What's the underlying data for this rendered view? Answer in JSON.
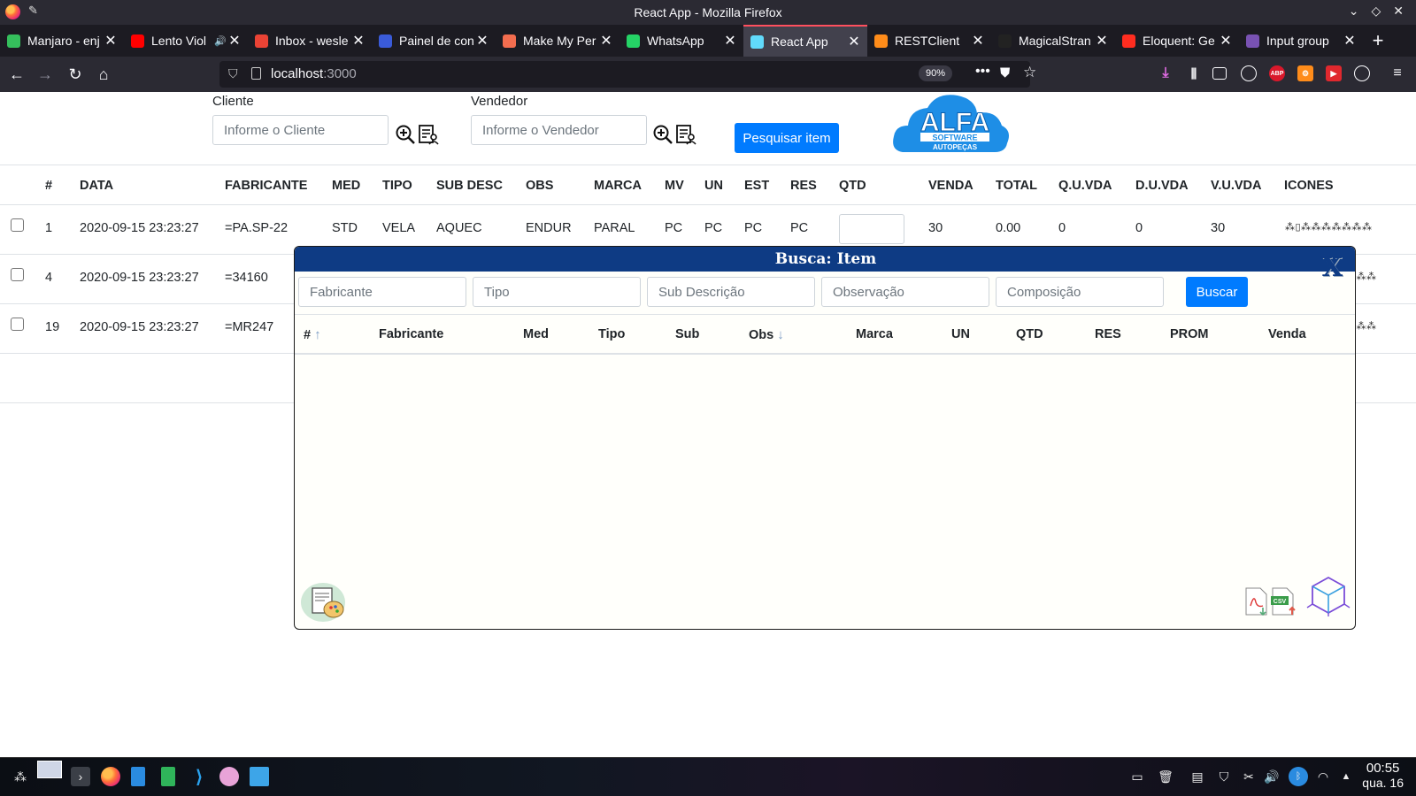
{
  "window": {
    "title": "React App - Mozilla Firefox"
  },
  "tabs": [
    {
      "label": "Manjaro - enj",
      "icon": "manjaro-icon",
      "color": "#35bf5c"
    },
    {
      "label": "Lento Viol",
      "icon": "youtube-icon",
      "color": "#ff0000"
    },
    {
      "label": "Inbox - wesle",
      "icon": "gmail-icon",
      "color": "#ea4335"
    },
    {
      "label": "Painel de con",
      "icon": "panel-icon",
      "color": "#3a5bd9"
    },
    {
      "label": "Make My Per",
      "icon": "make-icon",
      "color": "#f36d4f"
    },
    {
      "label": "WhatsApp",
      "icon": "whatsapp-icon",
      "color": "#25d366"
    },
    {
      "label": "React App",
      "icon": "react-icon",
      "color": "#61dafb"
    },
    {
      "label": "RESTClient",
      "icon": "restclient-icon",
      "color": "#ff8c1a"
    },
    {
      "label": "MagicalStran",
      "icon": "github-icon",
      "color": "#222222"
    },
    {
      "label": "Eloquent: Ge",
      "icon": "laravel-icon",
      "color": "#ff2d20"
    },
    {
      "label": "Input group",
      "icon": "bootstrap-icon",
      "color": "#7952b3"
    }
  ],
  "navbar": {
    "url_host": "localhost",
    "url_port": ":3000",
    "zoom": "90%"
  },
  "filters": {
    "cliente_label": "Cliente",
    "cliente_placeholder": "Informe o Cliente",
    "vendedor_label": "Vendedor",
    "vendedor_placeholder": "Informe o Vendedor",
    "search_button": "Pesquisar item"
  },
  "logo": {
    "text": "ALFA",
    "line1": "SOFTWARE",
    "line2": "AUTOPEÇAS",
    "color": "#1e8ee6"
  },
  "table": {
    "headers": [
      "#",
      "DATA",
      "FABRICANTE",
      "MED",
      "TIPO",
      "SUB DESC",
      "OBS",
      "MARCA",
      "MV",
      "UN",
      "EST",
      "RES",
      "QTD",
      "VENDA",
      "TOTAL",
      "Q.U.VDA",
      "D.U.VDA",
      "V.U.VDA",
      "ICONES"
    ],
    "rows": [
      {
        "num": "1",
        "data": "2020-09-15 23:23:27",
        "fabricante": "=PA.SP-22",
        "med": "STD",
        "tipo": "VELA",
        "sub": "AQUEC",
        "obs": "ENDUR",
        "marca": "PARAL",
        "mv": "PC",
        "un": "PC",
        "est": "PC",
        "res": "PC",
        "venda": "30",
        "total": "0.00",
        "quvda": "0",
        "duvda": "0",
        "vuvda": "30"
      },
      {
        "num": "4",
        "data": "2020-09-15 23:23:27",
        "fabricante": "=34160"
      },
      {
        "num": "19",
        "data": "2020-09-15 23:23:27",
        "fabricante": "=MR247"
      }
    ]
  },
  "modal": {
    "title": "Busca: Item",
    "close": "X",
    "placeholders": [
      "Fabricante",
      "Tipo",
      "Sub Descrição",
      "Observação",
      "Composição"
    ],
    "search_button": "Buscar",
    "headers": [
      "#",
      "Fabricante",
      "Med",
      "Tipo",
      "Sub",
      "Obs",
      "Marca",
      "UN",
      "QTD",
      "RES",
      "PROM",
      "Venda"
    ]
  },
  "taskbar": {
    "time": "00:55",
    "date": "qua. 16"
  }
}
